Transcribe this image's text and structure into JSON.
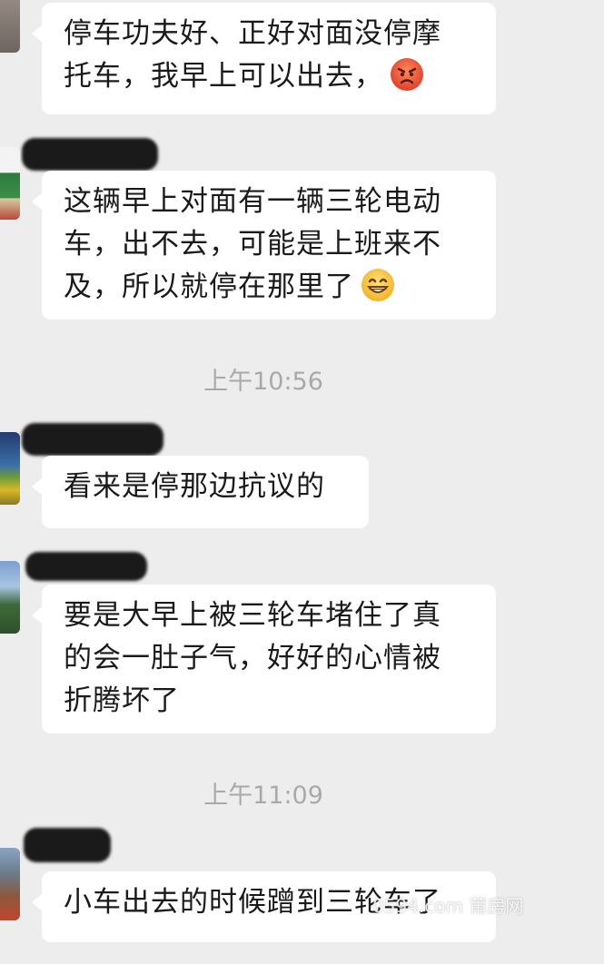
{
  "messages": [
    {
      "lines": [
        "停车功夫好、正好对面没停摩",
        "托车，我早上可以出去，"
      ],
      "emoji": "angry-face-emoji"
    },
    {
      "lines": [
        "这辆早上对面有一辆三轮电动",
        "车，出不去，可能是上班来不",
        "及，所以就停在那里了"
      ],
      "emoji": "grinning-face-emoji"
    },
    {
      "lines": [
        "看来是停那边抗议的"
      ]
    },
    {
      "lines": [
        "要是大早上被三轮车堵住了真",
        "的会一肚子气，好好的心情被",
        "折腾坏了"
      ]
    },
    {
      "lines": [
        "小车出去的时候蹭到三轮车了"
      ]
    }
  ],
  "timestamps": [
    "上午10:56",
    "上午11:09"
  ],
  "watermark": "0594.com 莆房网",
  "colors": {
    "background": "#ededed",
    "bubble": "#ffffff",
    "timestamp_text": "#a9a9a9"
  }
}
